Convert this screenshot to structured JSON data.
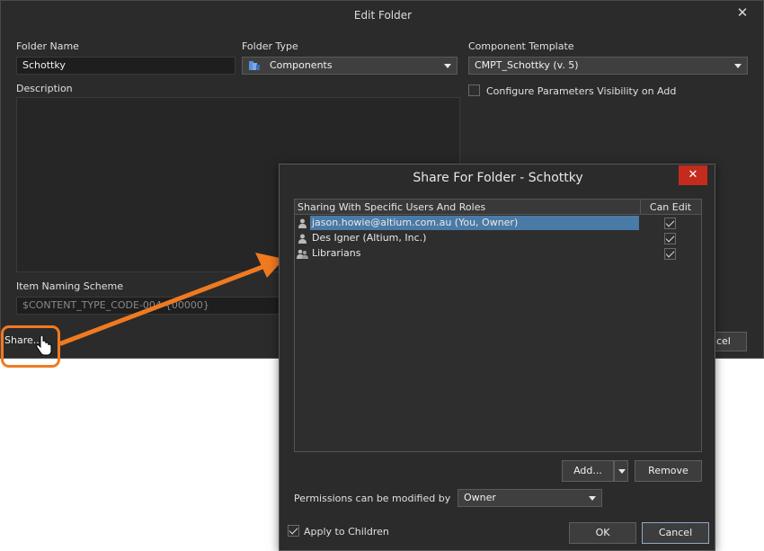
{
  "edit_folder": {
    "title": "Edit Folder",
    "close_glyph": "✕",
    "folder_name_label": "Folder Name",
    "folder_name_value": "Schottky",
    "folder_type_label": "Folder Type",
    "folder_type_value": "Components",
    "component_template_label": "Component Template",
    "component_template_value": "CMPT_Schottky (v. 5)",
    "configure_visibility_label": "Configure Parameters Visibility on Add",
    "description_label": "Description",
    "item_naming_label": "Item Naming Scheme",
    "item_naming_value": "$CONTENT_TYPE_CODE-004-{00000}",
    "share_button": "Share...",
    "cancel_button_partial": "ncel"
  },
  "share_dialog": {
    "title": "Share For Folder - Schottky",
    "close_glyph": "✕",
    "columns": [
      "Sharing With Specific Users And Roles",
      "Can Edit"
    ],
    "rows": [
      {
        "name": "jason.howie@altium.com.au (You, Owner)",
        "type": "user-icon",
        "can_edit": true,
        "selected": true
      },
      {
        "name": "Des Igner (Altium, Inc.)",
        "type": "user-icon",
        "can_edit": true,
        "selected": false
      },
      {
        "name": "Librarians",
        "type": "group-icon",
        "can_edit": true,
        "selected": false
      }
    ],
    "add_button": "Add...",
    "remove_button": "Remove",
    "permissions_label": "Permissions can be modified by",
    "permissions_value": "Owner",
    "apply_children_label": "Apply to Children",
    "apply_children_checked": true,
    "ok_button": "OK",
    "cancel_button": "Cancel"
  },
  "colors": {
    "dialog_bg": "#2b2b2b",
    "selection": "#4a7aa6",
    "close_red": "#c42b1c",
    "callout_orange": "#f07a20"
  }
}
